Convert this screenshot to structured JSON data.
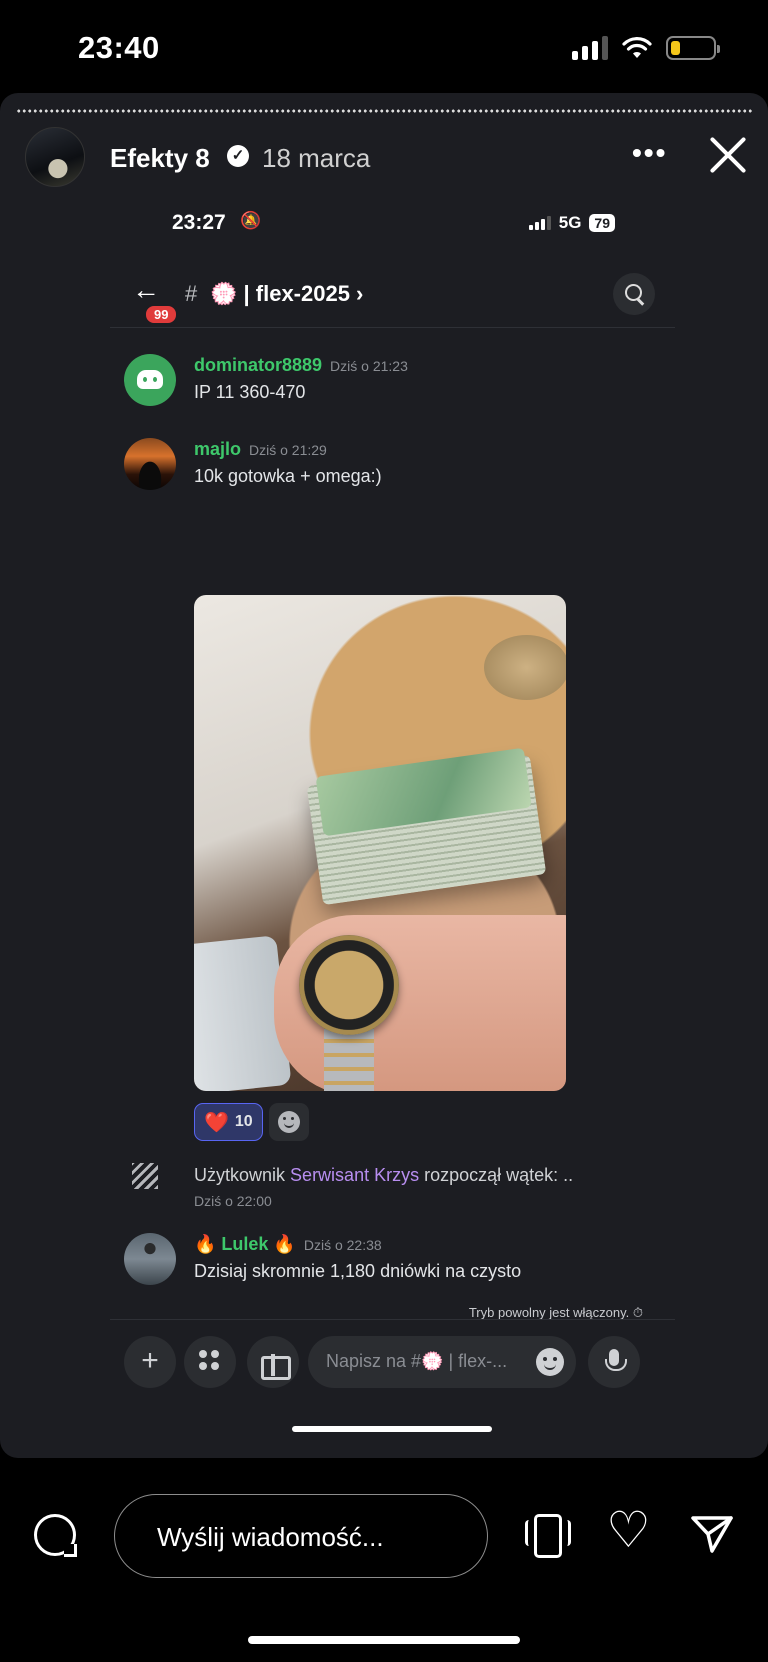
{
  "status_bar": {
    "time": "23:40"
  },
  "story": {
    "author": "Efekty 8",
    "date": "18 marca",
    "more_icon": "more-horizontal-icon",
    "close_icon": "close-icon"
  },
  "inner": {
    "status": {
      "time": "23:27",
      "network": "5G",
      "battery": "79"
    },
    "channel": {
      "back_badge": "99",
      "hash": "#",
      "name": "💮 | flex-2025 ›"
    },
    "messages": [
      {
        "user": "dominator8889",
        "time": "Dziś o 21:23",
        "text": "IP 11 360-470"
      },
      {
        "user": "majlo",
        "time": "Dziś o 21:29",
        "text": "10k gotowka + omega:)"
      },
      {
        "user": "🔥 Lulek 🔥",
        "time": "Dziś o 22:38",
        "text": "Dzisiaj skromnie 1,180 dniówki na czysto"
      }
    ],
    "reaction": {
      "emoji": "❤️",
      "count": "10"
    },
    "system": {
      "prefix": "Użytkownik",
      "user": "Serwisant Krzys",
      "suffix": "rozpoczął wątek: ..",
      "time": "Dziś o 22:00"
    },
    "slow_mode": "Tryb powolny jest włączony. ⏱",
    "composer": {
      "placeholder": "Napisz na #💮 | flex-..."
    }
  },
  "instagram": {
    "reply_placeholder": "Wyślij wiadomość..."
  }
}
